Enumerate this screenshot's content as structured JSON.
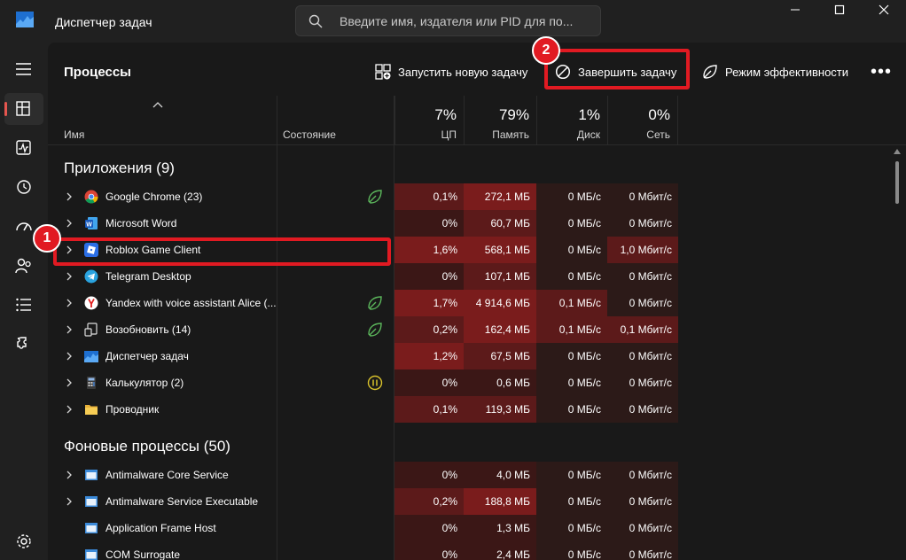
{
  "window": {
    "title": "Диспетчер задач",
    "search_placeholder": "Введите имя, издателя или PID для по...",
    "controls": [
      "minimize-icon",
      "maximize-icon",
      "close-icon"
    ]
  },
  "nav": {
    "items": [
      "hamburger-icon",
      "processes-icon",
      "performance-icon",
      "app-history-icon",
      "startup-icon",
      "users-icon",
      "details-icon",
      "services-icon",
      "settings-icon"
    ],
    "active": "processes-icon"
  },
  "page": {
    "title": "Процессы"
  },
  "toolbar": {
    "run_new_task": "Запустить новую задачу",
    "end_task": "Завершить задачу",
    "efficiency_mode": "Режим эффективности",
    "more": "•••"
  },
  "callouts": {
    "one": "1",
    "two": "2"
  },
  "table": {
    "col_name": "Имя",
    "col_state": "Состояние",
    "cpu_pct": "7%",
    "cpu_label": "ЦП",
    "mem_pct": "79%",
    "mem_label": "Память",
    "disk_pct": "1%",
    "disk_label": "Диск",
    "net_pct": "0%",
    "net_label": "Сеть"
  },
  "groups": {
    "apps_title": "Приложения (9)",
    "bg_title": "Фоновые процессы (50)"
  },
  "apps": [
    {
      "name": "Google Chrome (23)",
      "cpu": "0,1%",
      "mem": "272,1 МБ",
      "disk": "0 МБ/с",
      "net": "0 Мбит/с"
    },
    {
      "name": "Microsoft Word",
      "cpu": "0%",
      "mem": "60,7 МБ",
      "disk": "0 МБ/с",
      "net": "0 Мбит/с"
    },
    {
      "name": "Roblox Game Client",
      "cpu": "1,6%",
      "mem": "568,1 МБ",
      "disk": "0 МБ/с",
      "net": "1,0 Мбит/с"
    },
    {
      "name": "Telegram Desktop",
      "cpu": "0%",
      "mem": "107,1 МБ",
      "disk": "0 МБ/с",
      "net": "0 Мбит/с"
    },
    {
      "name": "Yandex with voice assistant Alice (...",
      "cpu": "1,7%",
      "mem": "4 914,6 МБ",
      "disk": "0,1 МБ/с",
      "net": "0 Мбит/с"
    },
    {
      "name": "Возобновить (14)",
      "cpu": "0,2%",
      "mem": "162,4 МБ",
      "disk": "0,1 МБ/с",
      "net": "0,1 Мбит/с"
    },
    {
      "name": "Диспетчер задач",
      "cpu": "1,2%",
      "mem": "67,5 МБ",
      "disk": "0 МБ/с",
      "net": "0 Мбит/с"
    },
    {
      "name": "Калькулятор (2)",
      "cpu": "0%",
      "mem": "0,6 МБ",
      "disk": "0 МБ/с",
      "net": "0 Мбит/с"
    },
    {
      "name": "Проводник",
      "cpu": "0,1%",
      "mem": "119,3 МБ",
      "disk": "0 МБ/с",
      "net": "0 Мбит/с"
    }
  ],
  "background": [
    {
      "name": "Antimalware Core Service",
      "cpu": "0%",
      "mem": "4,0 МБ",
      "disk": "0 МБ/с",
      "net": "0 Мбит/с"
    },
    {
      "name": "Antimalware Service Executable",
      "cpu": "0,2%",
      "mem": "188,8 МБ",
      "disk": "0 МБ/с",
      "net": "0 Мбит/с"
    },
    {
      "name": "Application Frame Host",
      "cpu": "0%",
      "mem": "1,3 МБ",
      "disk": "0 МБ/с",
      "net": "0 Мбит/с"
    },
    {
      "name": "COM Surrogate",
      "cpu": "0%",
      "mem": "2,4 МБ",
      "disk": "0 МБ/с",
      "net": "0 Мбит/с"
    }
  ],
  "colors": {
    "heat_high": "#7a1c1c",
    "heat_mid": "#5c1a1a",
    "heat_low": "#3b1716",
    "heat_none": "#2c1a18",
    "highlight": "#e11a22",
    "leaf": "#5cb85c",
    "paused": "#d9c22b"
  }
}
